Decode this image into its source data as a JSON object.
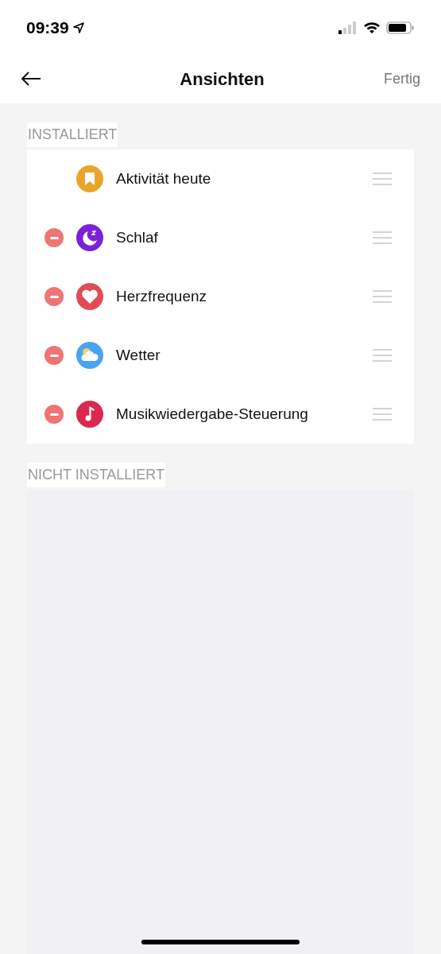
{
  "status_bar": {
    "time": "09:39"
  },
  "nav": {
    "title": "Ansichten",
    "action": "Fertig"
  },
  "sections": [
    {
      "header": "INSTALLIERT",
      "items": [
        {
          "label": "Aktivität heute",
          "kind": "activity",
          "removable": false
        },
        {
          "label": "Schlaf",
          "kind": "sleep",
          "removable": true
        },
        {
          "label": "Herzfrequenz",
          "kind": "heart",
          "removable": true
        },
        {
          "label": "Wetter",
          "kind": "weather",
          "removable": true
        },
        {
          "label": "Musikwiedergabe-Steuerung",
          "kind": "music",
          "removable": true
        }
      ]
    },
    {
      "header": "NICHT INSTALLIERT"
    }
  ]
}
